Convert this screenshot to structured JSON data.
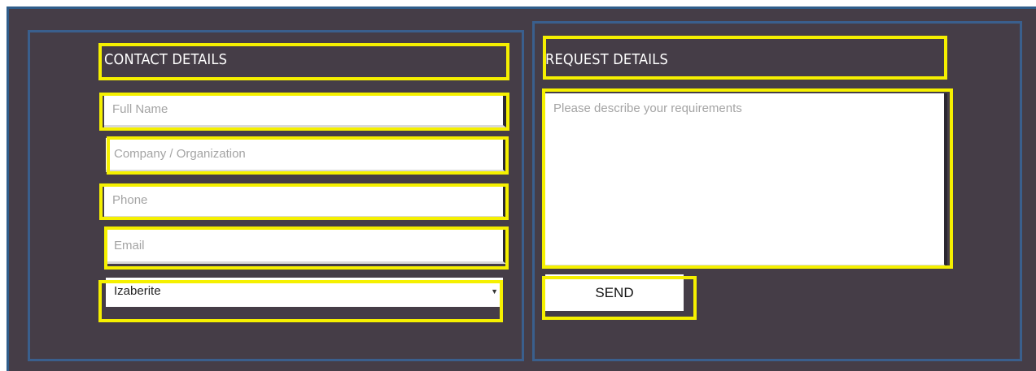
{
  "contact": {
    "heading": "CONTACT DETAILS",
    "full_name_placeholder": "Full Name",
    "company_placeholder": "Company / Organization",
    "phone_placeholder": "Phone",
    "email_placeholder": "Email",
    "select_value": "Izaberite"
  },
  "request": {
    "heading": "REQUEST DETAILS",
    "requirements_placeholder": "Please describe your requirements",
    "send_label": "SEND"
  },
  "colors": {
    "background": "#453d47",
    "panel_border": "#3a5f8d",
    "highlight": "#f5f000"
  },
  "icons": {
    "select_caret": "triangle-down"
  }
}
